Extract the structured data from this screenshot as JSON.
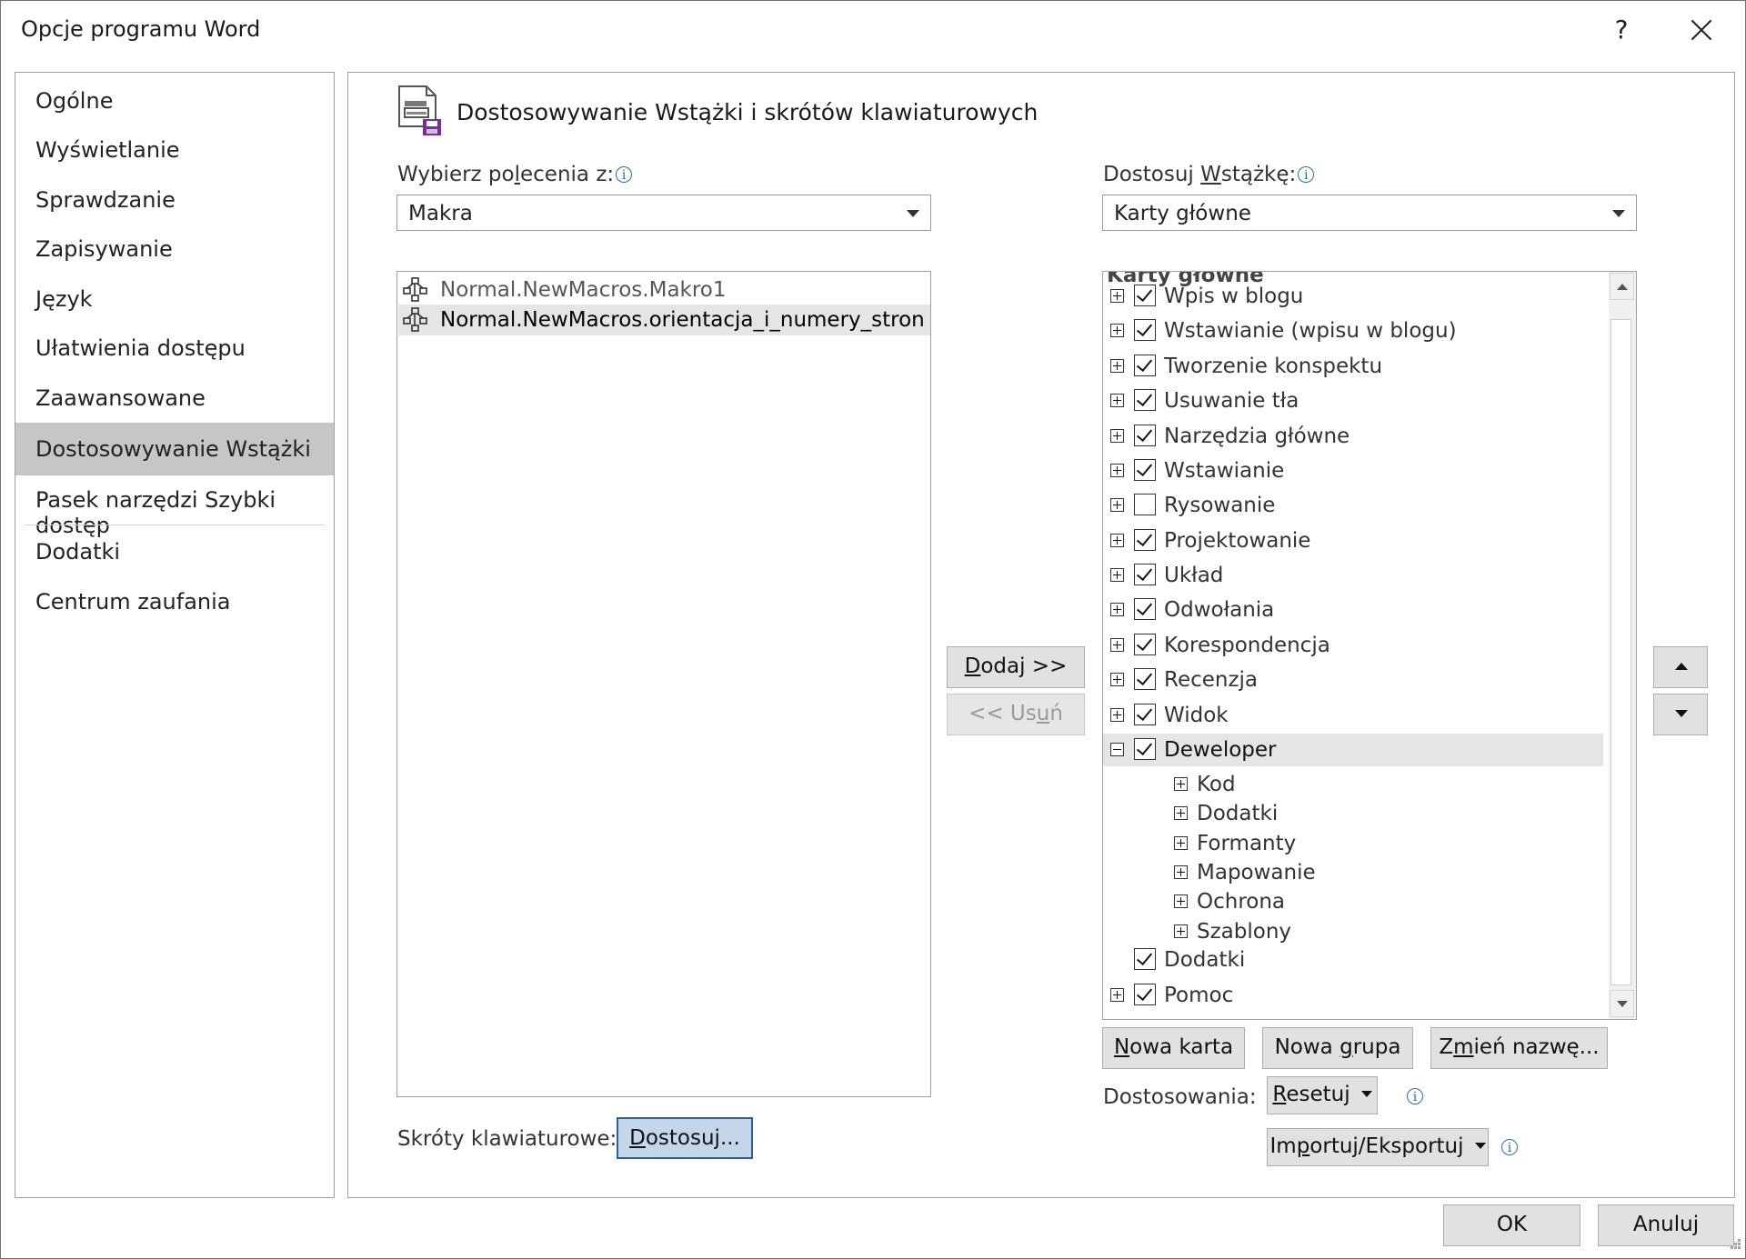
{
  "window": {
    "title": "Opcje programu Word",
    "help_label": "?",
    "close_icon": "close-icon"
  },
  "nav": {
    "items": [
      {
        "label": "Ogólne"
      },
      {
        "label": "Wyświetlanie"
      },
      {
        "label": "Sprawdzanie"
      },
      {
        "label": "Zapisywanie"
      },
      {
        "label": "Język"
      },
      {
        "label": "Ułatwienia dostępu"
      },
      {
        "label": "Zaawansowane"
      },
      {
        "label": "Dostosowywanie Wstążki",
        "selected": true
      },
      {
        "label": "Pasek narzędzi Szybki dostęp"
      },
      {
        "label": "Dodatki"
      },
      {
        "label": "Centrum zaufania"
      }
    ]
  },
  "page": {
    "heading": "Dostosowywanie Wstążki i skrótów klawiaturowych",
    "icon": "customize-ribbon-icon"
  },
  "commands": {
    "label_pre": "Wybierz po",
    "label_u": "l",
    "label_post": "ecenia z:",
    "info_icon": "i",
    "selected_value": "Makra",
    "items": [
      {
        "label": "Normal.NewMacros.Makro1",
        "icon": "macro-icon",
        "selected": false
      },
      {
        "label": "Normal.NewMacros.orientacja_i_numery_stron",
        "icon": "macro-icon",
        "selected": true
      }
    ]
  },
  "shortcuts": {
    "label": "Skróty klawiaturowe:",
    "button_u": "D",
    "button_rest": "ostosuj..."
  },
  "transfer": {
    "add_u": "D",
    "add_rest": "odaj >>",
    "remove_pre": "<< Us",
    "remove_u": "u",
    "remove_post": "ń"
  },
  "ribbon": {
    "label_pre": "Dostosuj ",
    "label_u": "W",
    "label_post": "stążkę:",
    "info_icon": "i",
    "selected_value": "Karty główne",
    "partial_header": "Karty główne",
    "tabs": [
      {
        "label": "Wpis w blogu",
        "checked": true,
        "expand": "plus"
      },
      {
        "label": "Wstawianie (wpisu w blogu)",
        "checked": true,
        "expand": "plus"
      },
      {
        "label": "Tworzenie konspektu",
        "checked": true,
        "expand": "plus"
      },
      {
        "label": "Usuwanie tła",
        "checked": true,
        "expand": "plus"
      },
      {
        "label": "Narzędzia główne",
        "checked": true,
        "expand": "plus"
      },
      {
        "label": "Wstawianie",
        "checked": true,
        "expand": "plus"
      },
      {
        "label": "Rysowanie",
        "checked": false,
        "expand": "plus"
      },
      {
        "label": "Projektowanie",
        "checked": true,
        "expand": "plus"
      },
      {
        "label": "Układ",
        "checked": true,
        "expand": "plus"
      },
      {
        "label": "Odwołania",
        "checked": true,
        "expand": "plus"
      },
      {
        "label": "Korespondencja",
        "checked": true,
        "expand": "plus"
      },
      {
        "label": "Recenzja",
        "checked": true,
        "expand": "plus"
      },
      {
        "label": "Widok",
        "checked": true,
        "expand": "plus"
      },
      {
        "label": "Deweloper",
        "checked": true,
        "expand": "minus",
        "selected": true
      }
    ],
    "groups": [
      {
        "label": "Kod"
      },
      {
        "label": "Dodatki"
      },
      {
        "label": "Formanty"
      },
      {
        "label": "Mapowanie"
      },
      {
        "label": "Ochrona"
      },
      {
        "label": "Szablony"
      }
    ],
    "tail": [
      {
        "label": "Dodatki",
        "checked": true,
        "expand": "none"
      },
      {
        "label": "Pomoc",
        "checked": true,
        "expand": "plus"
      }
    ],
    "new_tab_u": "N",
    "new_tab_rest": "owa karta",
    "new_group_pre": "Nowa ",
    "new_group_u": "g",
    "new_group_post": "rupa",
    "rename_pre": "Z",
    "rename_u": "m",
    "rename_post": "ień nazwę...",
    "customizations_label": "Dostosowania:",
    "reset_u": "R",
    "reset_rest": "esetuj",
    "import_export_pre": "Im",
    "import_export_u": "p",
    "import_export_post": "ortuj/Eksportuj"
  },
  "footer": {
    "ok_label": "OK",
    "cancel_label": "Anuluj"
  }
}
